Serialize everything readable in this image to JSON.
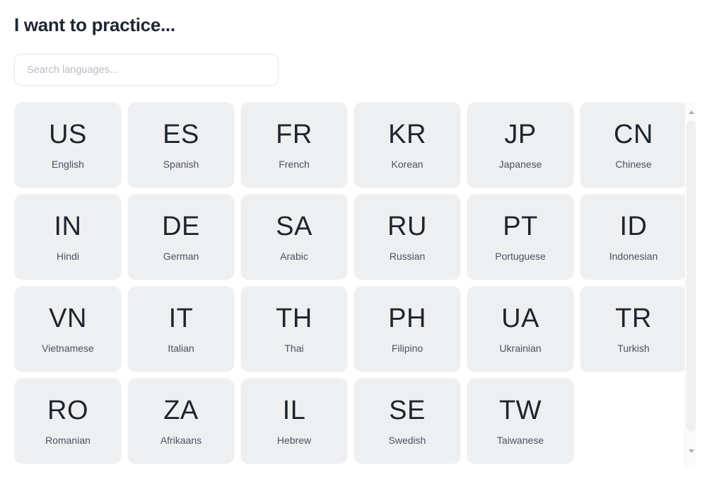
{
  "header": {
    "title": "I want to practice..."
  },
  "search": {
    "placeholder": "Search languages...",
    "value": ""
  },
  "colors": {
    "page_background": "#ffffff",
    "card_background": "#eeeff1",
    "title_text": "#1f2733",
    "code_text": "#1d252f",
    "label_text": "#4a5160",
    "placeholder_text": "#b9bcc4",
    "scrollbar_thumb": "#f0f0f0"
  },
  "languages": [
    {
      "code": "US",
      "label": "English"
    },
    {
      "code": "ES",
      "label": "Spanish"
    },
    {
      "code": "FR",
      "label": "French"
    },
    {
      "code": "KR",
      "label": "Korean"
    },
    {
      "code": "JP",
      "label": "Japanese"
    },
    {
      "code": "CN",
      "label": "Chinese"
    },
    {
      "code": "IN",
      "label": "Hindi"
    },
    {
      "code": "DE",
      "label": "German"
    },
    {
      "code": "SA",
      "label": "Arabic"
    },
    {
      "code": "RU",
      "label": "Russian"
    },
    {
      "code": "PT",
      "label": "Portuguese"
    },
    {
      "code": "ID",
      "label": "Indonesian"
    },
    {
      "code": "VN",
      "label": "Vietnamese"
    },
    {
      "code": "IT",
      "label": "Italian"
    },
    {
      "code": "TH",
      "label": "Thai"
    },
    {
      "code": "PH",
      "label": "Filipino"
    },
    {
      "code": "UA",
      "label": "Ukrainian"
    },
    {
      "code": "TR",
      "label": "Turkish"
    },
    {
      "code": "RO",
      "label": "Romanian"
    },
    {
      "code": "ZA",
      "label": "Afrikaans"
    },
    {
      "code": "IL",
      "label": "Hebrew"
    },
    {
      "code": "SE",
      "label": "Swedish"
    },
    {
      "code": "TW",
      "label": "Taiwanese"
    }
  ],
  "scrollbar": {
    "up_icon": "scroll-up-arrow-icon",
    "down_icon": "scroll-down-arrow-icon"
  }
}
